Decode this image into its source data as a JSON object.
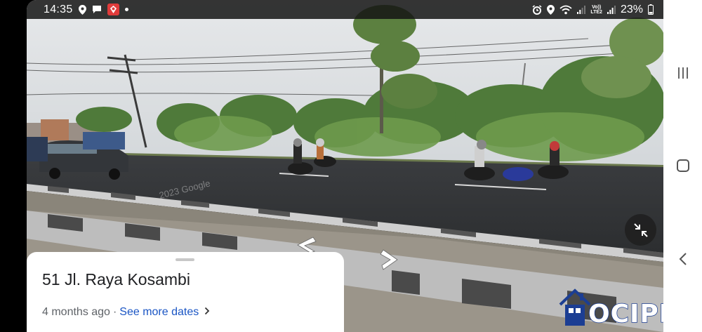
{
  "status_bar": {
    "time": "14:35",
    "battery_percent": "23%",
    "network_label_top": "Vo))",
    "network_label_bottom": "LTE2",
    "left_icons": [
      "location-icon",
      "chat-icon",
      "app-badge-icon",
      "dot-icon"
    ],
    "right_icons": [
      "alarm-icon",
      "location-icon",
      "wifi-icon",
      "signal-icon",
      "signal-icon",
      "battery-icon"
    ]
  },
  "street_view": {
    "watermark_text": "2023 Google",
    "nav_arrows": [
      "arrow-left-icon",
      "arrow-right-icon"
    ]
  },
  "info_card": {
    "address": "51 Jl. Raya Kosambi",
    "age": "4 months ago",
    "separator": "·",
    "see_more_label": "See more dates"
  },
  "collapse_button": {
    "icon": "collapse-icon"
  },
  "nav_bar": {
    "buttons": [
      "recents-icon",
      "home-icon",
      "back-icon"
    ]
  },
  "watermark": {
    "text": "OCIPROP",
    "color": "#1c3e93"
  }
}
